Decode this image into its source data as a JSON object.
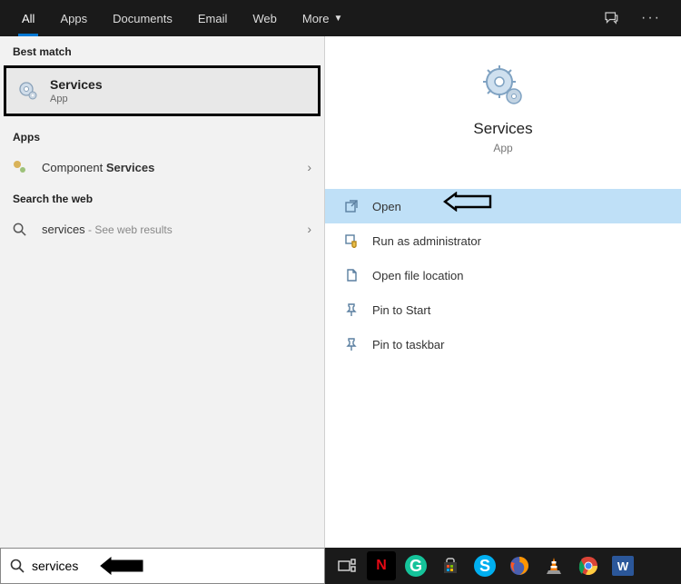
{
  "tabs": {
    "all": "All",
    "apps": "Apps",
    "documents": "Documents",
    "email": "Email",
    "web": "Web",
    "more": "More"
  },
  "sections": {
    "best_match": "Best match",
    "apps": "Apps",
    "search_web": "Search the web"
  },
  "best_match": {
    "title": "Services",
    "subtitle": "App"
  },
  "apps_list": {
    "component_pre": "Component ",
    "component_hl": "Services"
  },
  "web": {
    "term": "services",
    "suffix": " - See web results"
  },
  "detail": {
    "title": "Services",
    "subtitle": "App"
  },
  "actions": {
    "open": "Open",
    "run_admin": "Run as administrator",
    "open_loc": "Open file location",
    "pin_start": "Pin to Start",
    "pin_taskbar": "Pin to taskbar"
  },
  "search": {
    "value": "services"
  },
  "task_icons": [
    "task-view",
    "netflix",
    "grammarly",
    "microsoft-store",
    "skype",
    "firefox",
    "vlc",
    "chrome",
    "word"
  ]
}
